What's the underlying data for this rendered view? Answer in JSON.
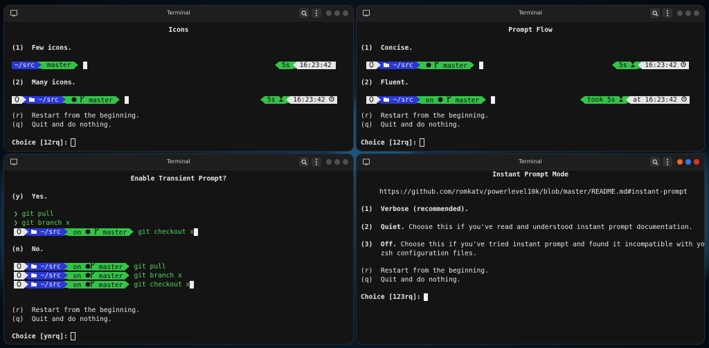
{
  "colors": {
    "dir_blue": "#2a38d6",
    "git_green": "#34c348",
    "time_bg": "#e6e6e6",
    "prompt_green": "#57d45f"
  },
  "icons": [
    "terminal-icon",
    "search-icon",
    "menu-icon",
    "window-dot-icon",
    "linux-icon",
    "folder-icon",
    "github-icon",
    "branch-icon",
    "hourglass-icon",
    "clock-icon",
    "prompt-chevron-icon"
  ],
  "windows": {
    "tl": {
      "title": "Terminal",
      "heading": "Icons",
      "opt1": "(1)  Few icons.",
      "opt2": "(2)  Many icons.",
      "p1": {
        "dir": "~/src",
        "git": "master",
        "dur": "5s",
        "time": "16:23:42"
      },
      "p2": {
        "dir": "~/src",
        "git": "master",
        "dur": "5s",
        "time": "16:23:42"
      },
      "restart": "(r)  Restart from the beginning.",
      "quit": "(q)  Quit and do nothing.",
      "choice": "Choice [12rq]:"
    },
    "tr": {
      "title": "Terminal",
      "heading": "Prompt Flow",
      "opt1": "(1)  Concise.",
      "opt2": "(2)  Fluent.",
      "p1": {
        "dir": "~/src",
        "git": "master",
        "dur": "5s",
        "time": "16:23:42"
      },
      "p2": {
        "dir": "~/src",
        "on": "on",
        "git": "master",
        "dur": "took 5s",
        "time": "at 16:23:42"
      },
      "restart": "(r)  Restart from the beginning.",
      "quit": "(q)  Quit and do nothing.",
      "choice": "Choice [12rq]:"
    },
    "bl": {
      "title": "Terminal",
      "heading": "Enable Transient Prompt?",
      "opt_y": "(y)  Yes.",
      "y_lines": [
        "git pull",
        "git branch x"
      ],
      "y_prompt": {
        "dir": "~/src",
        "on": "on",
        "git": "master",
        "cmd": "git checkout x"
      },
      "opt_n": "(n)  No.",
      "n_prompts": [
        {
          "dir": "~/src",
          "on": "on",
          "git": "master",
          "cmd": "git pull"
        },
        {
          "dir": "~/src",
          "on": "on",
          "git": "master",
          "cmd": "git branch x"
        },
        {
          "dir": "~/src",
          "on": "on",
          "git": "master",
          "cmd": "git checkout x"
        }
      ],
      "restart": "(r)  Restart from the beginning.",
      "quit": "(q)  Quit and do nothing.",
      "choice": "Choice [ynrq]:"
    },
    "br": {
      "title": "Terminal",
      "heading": "Instant Prompt Mode",
      "url": "https://github.com/romkatv/powerlevel10k/blob/master/README.md#instant-prompt",
      "opt1_key": "(1)  Verbose (recommended).",
      "opt2_key": "(2)  Quiet.",
      "opt2_text": " Choose this if you've read and understood instant prompt documentation.",
      "opt3_key": "(3)  Off.",
      "opt3_text": " Choose this if you've tried instant prompt and found it incompatible with your",
      "opt3_text2": "     zsh configuration files.",
      "restart": "(r)  Restart from the beginning.",
      "quit": "(q)  Quit and do nothing.",
      "choice": "Choice [123rq]:",
      "dots": [
        "#e8692b",
        "#3a78e8",
        "#d9342b"
      ]
    }
  }
}
